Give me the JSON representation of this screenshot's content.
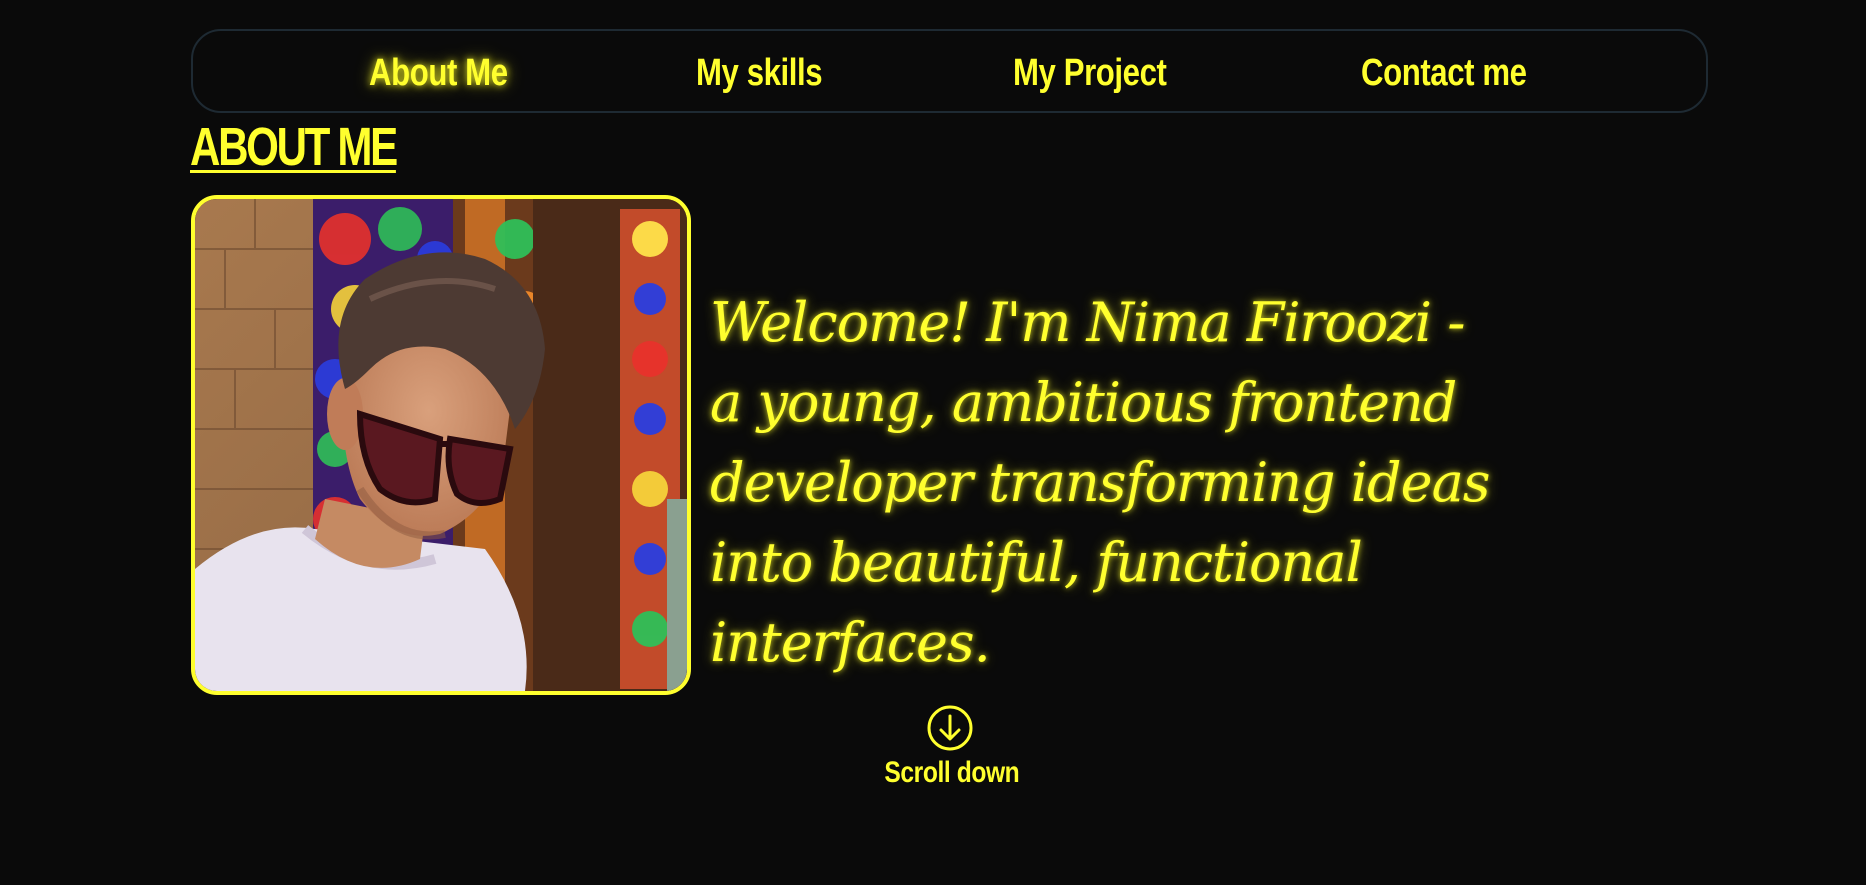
{
  "nav": {
    "items": [
      {
        "label": "About Me",
        "active": true
      },
      {
        "label": "My skills",
        "active": false
      },
      {
        "label": "My Project",
        "active": false
      },
      {
        "label": "Contact me",
        "active": false
      }
    ]
  },
  "about": {
    "title": "ABOUT ME",
    "intro": "Welcome! I'm Nima Firoozi - a young, ambitious frontend developer transforming ideas into beautiful, functional interfaces."
  },
  "scroll": {
    "label": "Scroll down",
    "icon": "arrow-down-circle-icon"
  },
  "colors": {
    "background": "#0a0a0a",
    "accent": "#ffff2e",
    "nav_border": "#1e2a33"
  }
}
